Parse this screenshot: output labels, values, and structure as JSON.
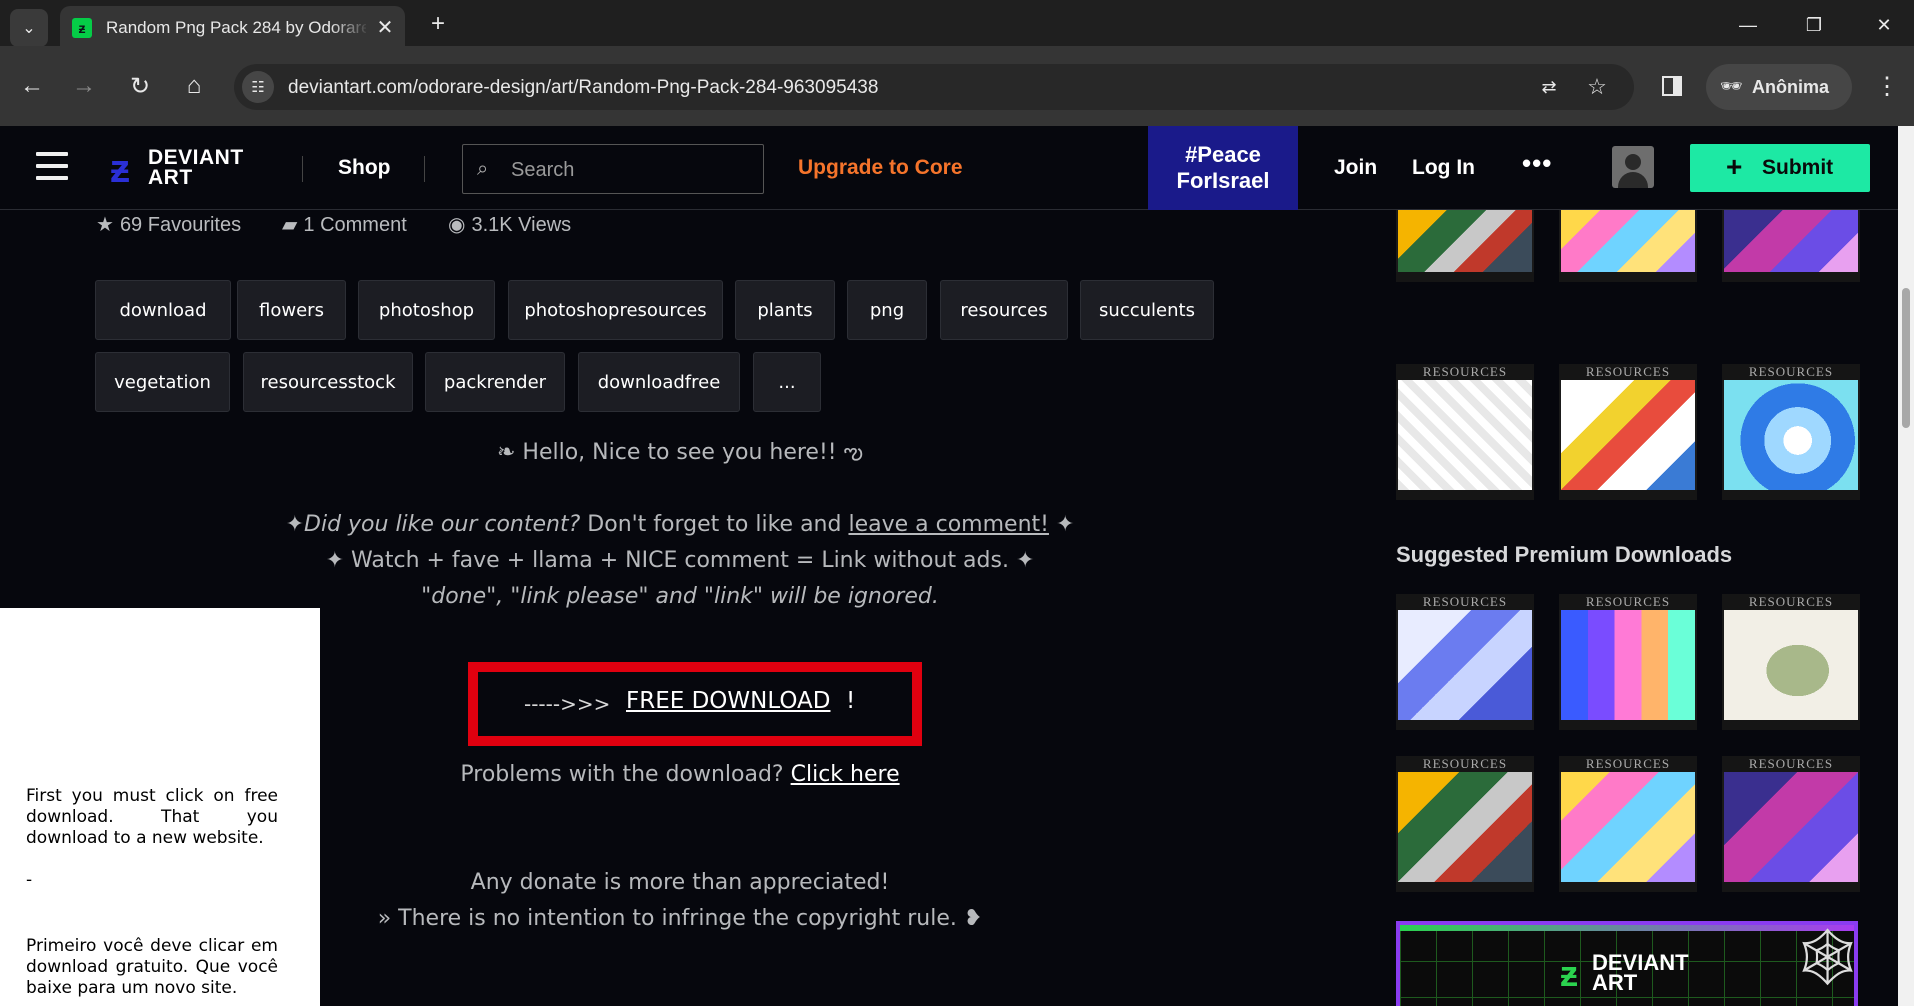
{
  "browser": {
    "tab_title": "Random Png Pack 284 by Odorare",
    "url": "deviantart.com/odorare-design/art/Random-Png-Pack-284-963095438",
    "profile_label": "Anônima"
  },
  "header": {
    "logo_line1": "DEVIANT",
    "logo_line2": "ART",
    "shop": "Shop",
    "search_placeholder": "Search",
    "upgrade": "Upgrade to Core",
    "peace_line1": "#Peace",
    "peace_line2": "ForIsrael",
    "join": "Join",
    "login": "Log In",
    "more": "•••",
    "submit": "Submit",
    "accent": "#1de9a4",
    "upgrade_color": "#f5742b"
  },
  "stats": {
    "favourites": "69 Favourites",
    "comments": "1 Comment",
    "views": "3.1K Views"
  },
  "tags": [
    "download",
    "flowers",
    "photoshop",
    "photoshopresources",
    "plants",
    "png",
    "resources",
    "succulents",
    "vegetation",
    "resourcesstock",
    "packrender",
    "downloadfree",
    "..."
  ],
  "description": {
    "hello": "❧ Hello, Nice to see you here!! ఌ",
    "line1_star_start": "✦",
    "line1_italic": "Did you like our content?",
    "line1_text": " Don't forget to like and ",
    "line1_link": "leave a comment!",
    "line1_star_end": " ✦",
    "line2": "✦ Watch + fave + llama + NICE comment = Link without ads. ✦",
    "line3": "\"done\", \"link please\" and \"link\" will be ignored.",
    "download_arrows": "----->>>",
    "download_link": "FREE DOWNLOAD",
    "download_bang": "!",
    "problems_text": "Problems with the download? ",
    "problems_link": "Click here",
    "donate": "Any donate is more than appreciated!",
    "copyright": "» There is no intention to infringe the copyright rule. ❥"
  },
  "popup": {
    "english": "First you must click on free download. That you download to a new website.",
    "dash": "-",
    "portuguese": "Primeiro você deve clicar em download gratuito. Que você baixe para um novo site."
  },
  "sidebar": {
    "thumb_label": "RESOURCES",
    "suggested_title": "Suggested Premium Downloads",
    "banner_logo_line1": "DEVIANT",
    "banner_logo_line2": "ART"
  }
}
